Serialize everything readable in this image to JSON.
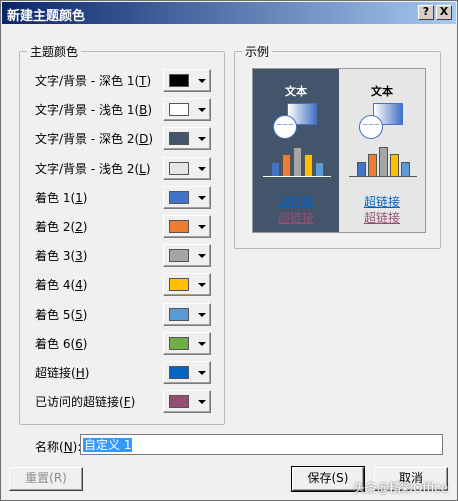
{
  "window": {
    "title": "新建主题颜色",
    "help_label": "?",
    "close_label": "X"
  },
  "theme_colors": {
    "legend": "主题颜色",
    "rows": [
      {
        "label": "文字/背景 - 深色 1(",
        "key": "T",
        "end": ")",
        "color": "#000000"
      },
      {
        "label": "文字/背景 - 浅色 1(",
        "key": "B",
        "end": ")",
        "color": "#ffffff"
      },
      {
        "label": "文字/背景 - 深色 2(",
        "key": "D",
        "end": ")",
        "color": "#44546a"
      },
      {
        "label": "文字/背景 - 浅色 2(",
        "key": "L",
        "end": ")",
        "color": "#e7e6e6"
      },
      {
        "label": "着色 1(",
        "key": "1",
        "end": ")",
        "color": "#4472c4"
      },
      {
        "label": "着色 2(",
        "key": "2",
        "end": ")",
        "color": "#ed7d31"
      },
      {
        "label": "着色 3(",
        "key": "3",
        "end": ")",
        "color": "#a5a5a5"
      },
      {
        "label": "着色 4(",
        "key": "4",
        "end": ")",
        "color": "#ffc000"
      },
      {
        "label": "着色 5(",
        "key": "5",
        "end": ")",
        "color": "#5b9bd5"
      },
      {
        "label": "着色 6(",
        "key": "6",
        "end": ")",
        "color": "#70ad47"
      },
      {
        "label": "超链接(",
        "key": "H",
        "end": ")",
        "color": "#0563c1"
      },
      {
        "label": "已访问的超链接(",
        "key": "F",
        "end": ")",
        "color": "#954f72"
      }
    ]
  },
  "sample": {
    "legend": "示例",
    "text_label": "文本",
    "hyperlink": "超链接",
    "visited": "超链接",
    "bubble_text": "~~~",
    "bar_values": [
      2,
      3,
      4,
      3,
      2
    ]
  },
  "name": {
    "label": "名称(",
    "key": "N",
    "end": "):",
    "value": "自定义 1"
  },
  "buttons": {
    "reset": "重置(R)",
    "save": "保存(S)",
    "cancel": "取消"
  },
  "watermark": "头条@精彩Office"
}
